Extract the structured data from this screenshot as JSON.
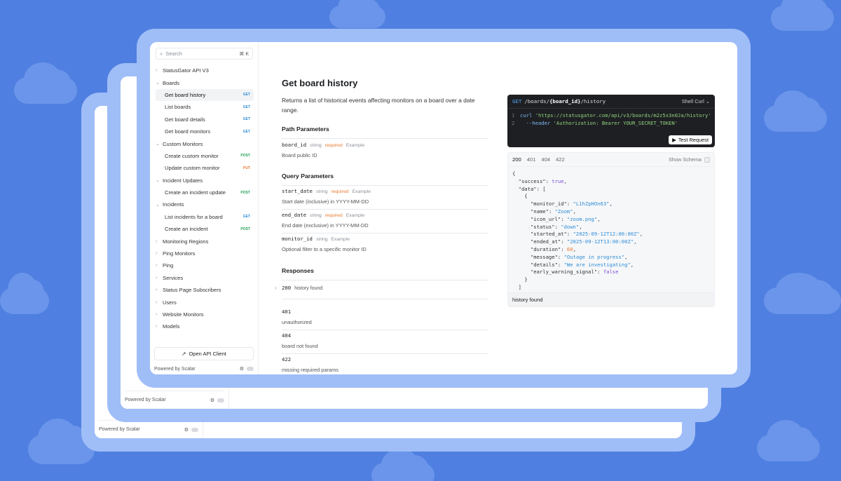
{
  "sidebar": {
    "search_placeholder": "Search",
    "search_shortcut": "⌘ K",
    "items": [
      {
        "label": "StatusGator API V3",
        "chev": "›",
        "level": 0
      },
      {
        "label": "Boards",
        "chev": "⌄",
        "level": 0
      },
      {
        "label": "Get board history",
        "level": 1,
        "badge": "GET",
        "active": true
      },
      {
        "label": "List boards",
        "level": 1,
        "badge": "GET"
      },
      {
        "label": "Get board details",
        "level": 1,
        "badge": "GET"
      },
      {
        "label": "Get board monitors",
        "level": 1,
        "badge": "GET"
      },
      {
        "label": "Custom Monitors",
        "chev": "⌄",
        "level": 0
      },
      {
        "label": "Create custom monitor",
        "level": 1,
        "badge": "POST"
      },
      {
        "label": "Update custom monitor",
        "level": 1,
        "badge": "PUT"
      },
      {
        "label": "Incident Updates",
        "chev": "⌄",
        "level": 0
      },
      {
        "label": "Create an incident update",
        "level": 1,
        "badge": "POST"
      },
      {
        "label": "Incidents",
        "chev": "⌄",
        "level": 0
      },
      {
        "label": "List incidents for a board",
        "level": 1,
        "badge": "GET"
      },
      {
        "label": "Create an incident",
        "level": 1,
        "badge": "POST"
      },
      {
        "label": "Monitoring Regions",
        "chev": "›",
        "level": 0
      },
      {
        "label": "Ping Monitors",
        "chev": "›",
        "level": 0
      },
      {
        "label": "Ping",
        "chev": "›",
        "level": 0
      },
      {
        "label": "Services",
        "chev": "›",
        "level": 0
      },
      {
        "label": "Status Page Subscribers",
        "chev": "›",
        "level": 0
      },
      {
        "label": "Users",
        "chev": "›",
        "level": 0
      },
      {
        "label": "Website Monitors",
        "chev": "›",
        "level": 0
      },
      {
        "label": "Models",
        "chev": "›",
        "level": 0
      }
    ],
    "open_client": "Open API Client",
    "open_client_icon": "↗",
    "powered_by": "Powered by Scalar",
    "settings_icon": "⚙"
  },
  "background_windows": {
    "powered_by": "Powered by Scalar",
    "open_client": "Open API Client"
  },
  "main": {
    "title_method": "Get",
    "title_rest": " board history",
    "description": "Returns a list of historical events affecting monitors on a board over a date range.",
    "path_params_heading": "Path Parameters",
    "path_params": [
      {
        "name": "board_id",
        "type": "string",
        "required": "required",
        "example": "Example",
        "description": "Board public ID"
      }
    ],
    "query_params_heading": "Query Parameters",
    "query_params": [
      {
        "name": "start_date",
        "type": "string",
        "required": "required",
        "example": "Example",
        "description": "Start date (inclusive) in YYYY-MM-DD"
      },
      {
        "name": "end_date",
        "type": "string",
        "required": "required",
        "example": "Example",
        "description": "End date (exclusive) in YYYY-MM-DD"
      },
      {
        "name": "monitor_id",
        "type": "string",
        "required": "",
        "example": "Example",
        "description": "Optional filter to a specific monitor ID"
      }
    ],
    "responses_heading": "Responses",
    "responses": [
      {
        "code": "200",
        "description": "history found",
        "expandable": true
      },
      {
        "code": "401",
        "description": "unauthorized"
      },
      {
        "code": "404",
        "description": "board not found"
      },
      {
        "code": "422",
        "description": "missing required params"
      }
    ]
  },
  "request": {
    "method": "GET",
    "path_prefix": "/boards/",
    "path_param": "{board_id}",
    "path_suffix": "/history",
    "client": "Shell Curl ⌄",
    "lines": [
      {
        "num": "1",
        "cmd": "curl ",
        "value": "'https://statusgator.com/api/v3/boards/m2z5x3n0Ja/history'"
      },
      {
        "num": "2",
        "cmd": "  --header ",
        "value": "'Authorization: Bearer YOUR_SECRET_TOKEN'"
      }
    ],
    "test_button": "Test Request",
    "test_icon": "▶"
  },
  "response_example": {
    "tabs": [
      "200",
      "401",
      "404",
      "422"
    ],
    "show_schema": "Show Schema",
    "footer": "history found",
    "json": {
      "success": "true",
      "monitor_id": "\"L1hZpHOn63\"",
      "name": "\"Zoom\"",
      "icon_url": "\"zoom.png\"",
      "status": "\"down\"",
      "started_at": "\"2025-09-12T12:00:00Z\"",
      "ended_at": "\"2025-09-12T13:00:00Z\"",
      "duration": "60",
      "message": "\"Outage in progress\"",
      "details": "\"We are investigating\"",
      "early_warning_signal": "false"
    }
  }
}
